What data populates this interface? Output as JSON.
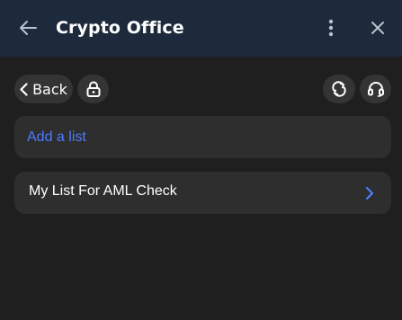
{
  "header": {
    "title": "Crypto Office",
    "back_icon": "arrow-left-icon",
    "more_icon": "more-vertical-icon",
    "close_icon": "close-icon"
  },
  "toolbar": {
    "back_label": "Back",
    "lock_icon": "lock-icon",
    "refresh_icon": "refresh-icon",
    "support_icon": "headset-icon"
  },
  "add_list": {
    "placeholder": "Add a list"
  },
  "lists": [
    {
      "name": "My List For AML Check"
    }
  ],
  "colors": {
    "header_bg": "#1d2a3b",
    "body_bg": "#1f1f1f",
    "card_bg": "#2e2e2e",
    "pill_bg": "#343434",
    "accent": "#4d7bff"
  }
}
